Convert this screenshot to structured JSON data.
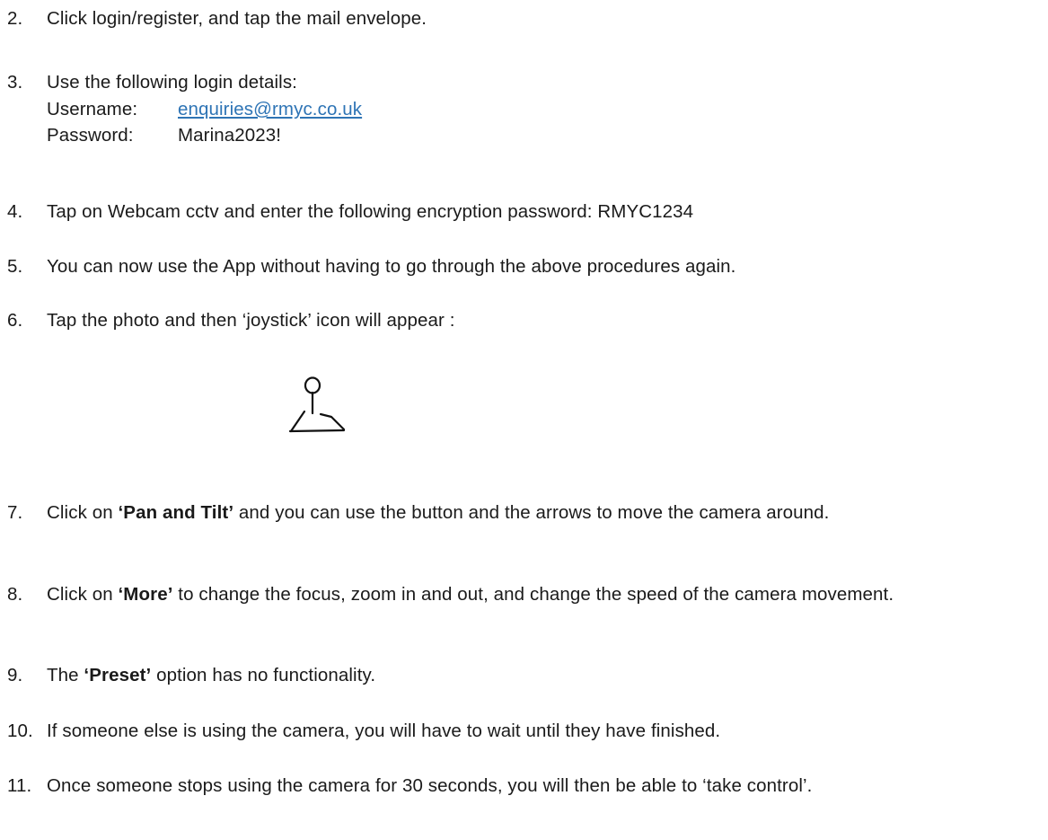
{
  "steps": [
    {
      "number": "2.",
      "text": "Click login/register, and tap the mail envelope."
    },
    {
      "number": "3.",
      "text": "Use the following login details:"
    },
    {
      "number": "4.",
      "text": "Tap on Webcam cctv and enter the following encryption password:  RMYC1234"
    },
    {
      "number": "5.",
      "text": "You can now use the App without having to go through the above procedures again."
    },
    {
      "number": "6.",
      "text": "Tap the photo and then ‘joystick’ icon will appear :"
    },
    {
      "number": "7.",
      "before": "Click on ",
      "bold": "‘Pan and Tilt’",
      "after": " and you can use the button and the arrows to move the camera around."
    },
    {
      "number": "8.",
      "before": "Click on ",
      "bold": "‘More’",
      "after": " to change the focus, zoom in and out, and change the speed of the camera movement."
    },
    {
      "number": "9.",
      "before": "The ",
      "bold": "‘Preset’",
      "after": " option has no functionality."
    },
    {
      "number": "10.",
      "text": "If someone else is using the camera, you will have to wait until they have finished."
    },
    {
      "number": "11.",
      "text": "Once someone stops using the camera for 30 seconds, you will then be able to ‘take control’."
    }
  ],
  "login": {
    "username_label": "Username:",
    "username_value": "enquiries@rmyc.co.uk",
    "password_label": "Password:",
    "password_value": "Marina2023!"
  },
  "icons": {
    "joystick": "joystick-icon"
  }
}
